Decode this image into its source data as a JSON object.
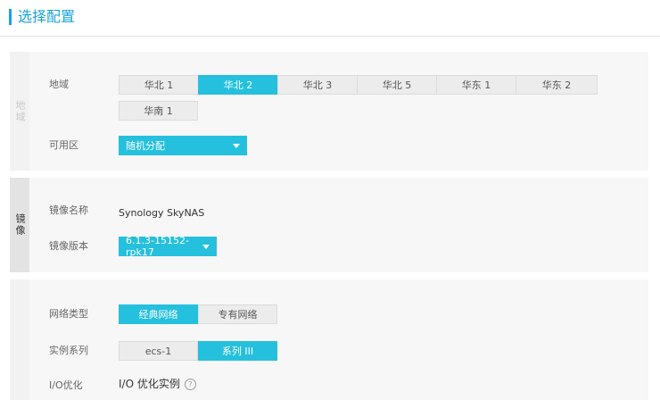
{
  "header": {
    "title": "选择配置"
  },
  "region_section": {
    "tab_label": "地域",
    "region_label": "地域",
    "regions": [
      {
        "label": "华北 1",
        "active": false
      },
      {
        "label": "华北 2",
        "active": true
      },
      {
        "label": "华北 3",
        "active": false
      },
      {
        "label": "华北 5",
        "active": false
      },
      {
        "label": "华东 1",
        "active": false
      },
      {
        "label": "华东 2",
        "active": false
      },
      {
        "label": "华南 1",
        "active": false
      }
    ],
    "zone_label": "可用区",
    "zone_value": "随机分配"
  },
  "image_section": {
    "tab_label": "镜像",
    "name_label": "镜像名称",
    "name_value": "Synology SkyNAS",
    "version_label": "镜像版本",
    "version_value": "6.1.3-15152-rpk17"
  },
  "network_section": {
    "network_type_label": "网络类型",
    "network_types": [
      {
        "label": "经典网络",
        "active": true
      },
      {
        "label": "专有网络",
        "active": false
      }
    ],
    "instance_family_label": "实例系列",
    "instance_families": [
      {
        "label": "ecs-1",
        "active": false
      },
      {
        "label": "系列 III",
        "active": true
      }
    ],
    "io_label": "I/O优化",
    "io_value": "I/O 优化实例",
    "help_icon": "question-circle-icon",
    "help_glyph": "?"
  },
  "colors": {
    "accent": "#25c0dd",
    "title": "#1aa3d9"
  }
}
